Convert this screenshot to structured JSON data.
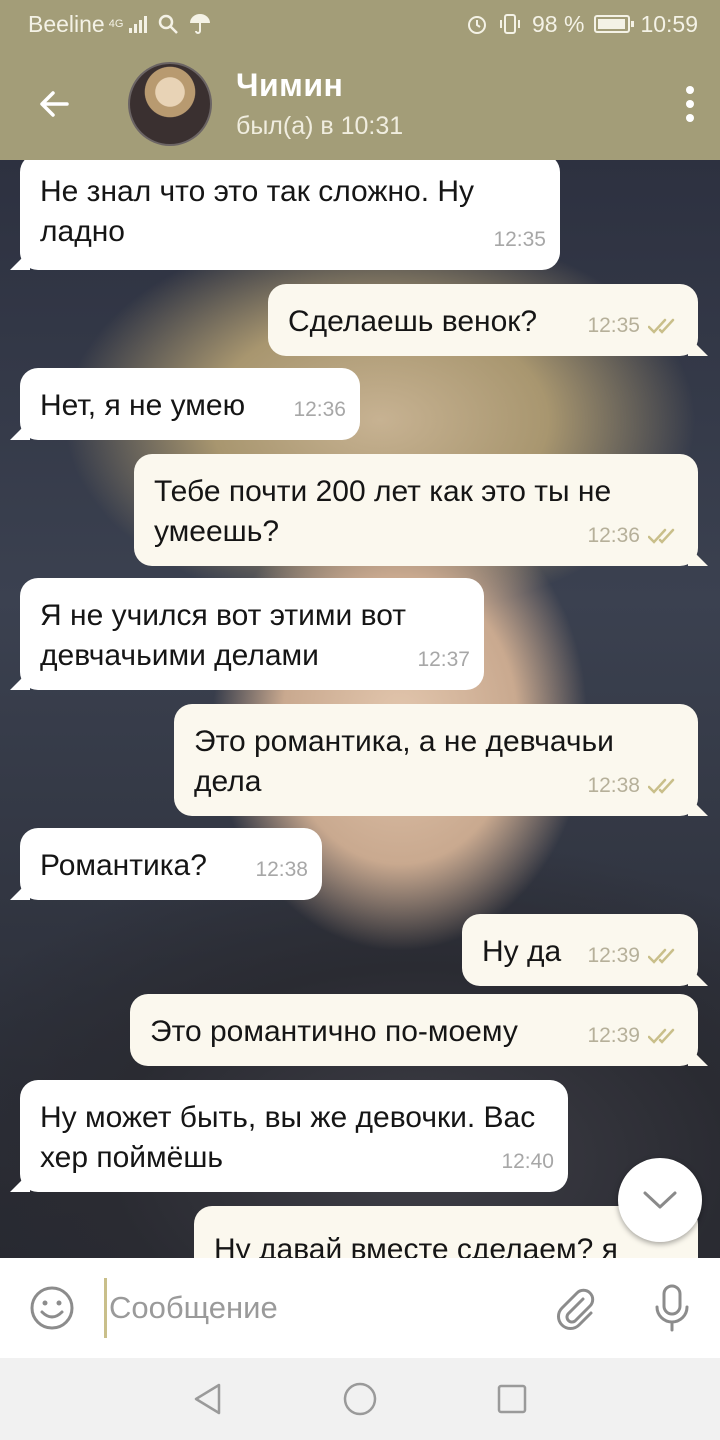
{
  "status_bar": {
    "carrier": "Beeline",
    "network": "4G",
    "battery": "98 %",
    "time": "10:59"
  },
  "header": {
    "contact_name": "Чимин",
    "last_seen": "был(а) в 10:31"
  },
  "messages": [
    {
      "direction": "in",
      "text": "Не знал что это так сложно. Ну ладно",
      "time": "12:35"
    },
    {
      "direction": "out",
      "text": "Сделаешь венок?",
      "time": "12:35",
      "read": true
    },
    {
      "direction": "in",
      "text": "Нет, я не умею",
      "time": "12:36"
    },
    {
      "direction": "out",
      "text": "Тебе почти 200 лет как это ты не умеешь?",
      "time": "12:36",
      "read": true
    },
    {
      "direction": "in",
      "text": "Я не учился вот этими вот девчачьими делами",
      "time": "12:37"
    },
    {
      "direction": "out",
      "text": "Это романтика, а не девчачьи дела",
      "time": "12:38",
      "read": true
    },
    {
      "direction": "in",
      "text": "Романтика?",
      "time": "12:38"
    },
    {
      "direction": "out",
      "text": "Ну да",
      "time": "12:39",
      "read": true
    },
    {
      "direction": "out",
      "text": "Это романтично по-моему",
      "time": "12:39",
      "read": true
    },
    {
      "direction": "in",
      "text": "Ну может быть, вы же девочки. Вас хер поймёшь",
      "time": "12:40"
    },
    {
      "direction": "out",
      "text": "Ну давай вместе сделаем? я",
      "time": ""
    }
  ],
  "composer": {
    "placeholder": "Сообщение"
  },
  "colors": {
    "accent": "#a39d78",
    "incoming_bubble": "#ffffff",
    "outgoing_bubble": "#fbf8ee",
    "read_check": "#c9bf8a"
  }
}
